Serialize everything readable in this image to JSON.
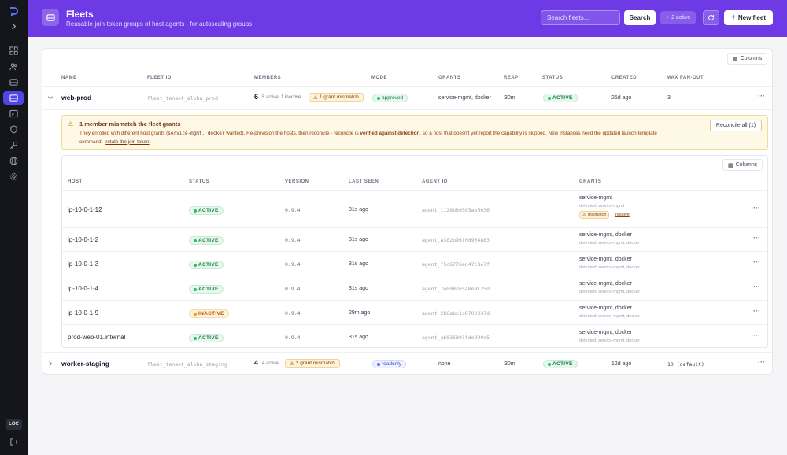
{
  "sidebar": {
    "items": [
      {
        "name": "grid-icon"
      },
      {
        "name": "users-icon"
      },
      {
        "name": "server-icon"
      },
      {
        "name": "fleets-icon",
        "active": true
      },
      {
        "name": "terminal-icon"
      },
      {
        "name": "shield-icon"
      },
      {
        "name": "key-icon"
      },
      {
        "name": "globe-icon"
      },
      {
        "name": "gear-icon"
      }
    ],
    "loc_label": "LOC"
  },
  "header": {
    "title": "Fleets",
    "subtitle": "Reusable-join-token groups of host agents - for autoscaling groups",
    "search_placeholder": "Search fleets...",
    "search_button": "Search",
    "active_pill": "2 active",
    "new_fleet": "New fleet"
  },
  "table": {
    "columns_button": "Columns",
    "headers": [
      "NAME",
      "FLEET ID",
      "MEMBERS",
      "MODE",
      "GRANTS",
      "REAP",
      "STATUS",
      "CREATED",
      "MAX FAN-OUT"
    ],
    "fleets": [
      {
        "name": "web-prod",
        "fleet_id": "fleet_tenant_alpha_prod",
        "members_count": "6",
        "members_detail": "5 active, 1 inactive",
        "mismatch": "1 grant mismatch",
        "mode": "approved",
        "grants": "service-mgmt, docker",
        "reap": "30m",
        "status": "ACTIVE",
        "created": "25d ago",
        "max_fanout": "3"
      },
      {
        "name": "worker-staging",
        "fleet_id": "fleet_tenant_alpha_staging",
        "members_count": "4",
        "members_detail": "4 active",
        "mismatch": "2 grant mismatch",
        "mode": "readonly",
        "grants": "none",
        "reap": "30m",
        "status": "ACTIVE",
        "created": "12d ago",
        "max_fanout": "10 (default)"
      }
    ]
  },
  "banner": {
    "title": "1 member mismatch the fleet grants",
    "line1_a": "They enrolled with different host grants (",
    "line1_code": "service-mgmt, docker",
    "line1_b": " wanted). Re-provision the hosts, then reconcile - reconcile is ",
    "line1_bold": "verified against detection",
    "line1_c": ", so a host that doesn't yet report the capability is skipped. New instances need the updated launch-template",
    "line2_a": "command - ",
    "line2_link": "rotate the join token",
    "line2_b": ".",
    "reconcile_button": "Reconcile all (1)"
  },
  "members": {
    "columns_button": "Columns",
    "headers": [
      "HOST",
      "STATUS",
      "VERSION",
      "LAST SEEN",
      "AGENT ID",
      "GRANTS"
    ],
    "rows": [
      {
        "host": "ip-10-0-1-12",
        "status": "ACTIVE",
        "version": "0.9.4",
        "last_seen": "31s ago",
        "agent_id": "agent_1128b80585ae6036",
        "grants": "service-mgmt",
        "detected": "detected: service-mgmt",
        "mismatch": "mismatch",
        "resolve": "resolve"
      },
      {
        "host": "ip-10-0-1-2",
        "status": "ACTIVE",
        "version": "0.9.4",
        "last_seen": "31s ago",
        "agent_id": "agent_a382b96f08904883",
        "grants": "service-mgmt, docker",
        "detected": "detected: service-mgmt, docker"
      },
      {
        "host": "ip-10-0-1-3",
        "status": "ACTIVE",
        "version": "0.9.4",
        "last_seen": "31s ago",
        "agent_id": "agent_f5c6776ad47c8e7f",
        "grants": "service-mgmt, docker",
        "detected": "detected: service-mgmt, docker"
      },
      {
        "host": "ip-10-0-1-4",
        "status": "ACTIVE",
        "version": "0.9.4",
        "last_seen": "31s ago",
        "agent_id": "agent_7e008265a0e9125d",
        "grants": "service-mgmt, docker",
        "detected": "detected: service-mgmt, docker"
      },
      {
        "host": "ip-10-0-1-9",
        "status": "INACTIVE",
        "version": "0.9.4",
        "last_seen": "29m ago",
        "agent_id": "agent_2b6abc1c8700037d",
        "grants": "service-mgmt, docker",
        "detected": "detected: service-mgmt, docker"
      },
      {
        "host": "prod-web-01.internal",
        "status": "ACTIVE",
        "version": "0.9.4",
        "last_seen": "31s ago",
        "agent_id": "agent_a6835891fde999c5",
        "grants": "service-mgmt, docker",
        "detected": "detected: service-mgmt, docker"
      }
    ]
  },
  "colors": {
    "brand": "#6d3ae6",
    "sidebar": "#14161b",
    "active_nav": "#4f46e5",
    "success": "#15803d",
    "warning": "#b45309"
  }
}
